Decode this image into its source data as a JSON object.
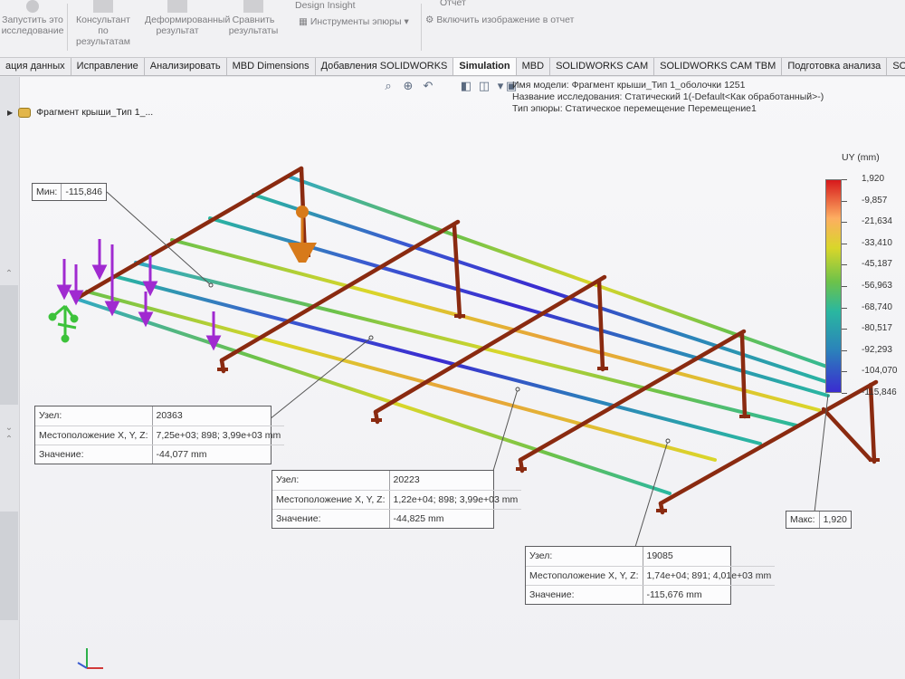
{
  "ribbon": {
    "run_study": "Запустить это исследование",
    "consultant": "Консультант по результатам",
    "deformed": "Деформированный результат",
    "compare": "Сравнить результаты",
    "design_insight": "Design Insight",
    "plot_tools": "Инструменты эпюры",
    "report": "Отчет",
    "include_image": "Включить изображение в отчет"
  },
  "tabs": [
    {
      "label": "ация данных",
      "active": false
    },
    {
      "label": "Исправление",
      "active": false
    },
    {
      "label": "Анализировать",
      "active": false
    },
    {
      "label": "MBD Dimensions",
      "active": false
    },
    {
      "label": "Добавления SOLIDWORKS",
      "active": false
    },
    {
      "label": "Simulation",
      "active": true
    },
    {
      "label": "MBD",
      "active": false
    },
    {
      "label": "SOLIDWORKS CAM",
      "active": false
    },
    {
      "label": "SOLIDWORKS CAM TBM",
      "active": false
    },
    {
      "label": "Подготовка анализа",
      "active": false
    },
    {
      "label": "SOLIDWORKS Inspection",
      "active": false
    }
  ],
  "tree": {
    "label": "Фрагмент крыши_Тип 1_..."
  },
  "info": {
    "model_name": "Имя модели: Фрагмент крыши_Тип 1_оболочки 1251",
    "study_name": "Название исследования: Статический 1(-Default<Как обработанный>-)",
    "plot_type": "Тип эпюры: Статическое перемещение Перемещение1"
  },
  "legend": {
    "unit": "UY (mm)",
    "labels": [
      "1,920",
      "-9,857",
      "-21,634",
      "-33,410",
      "-45,187",
      "-56,963",
      "-68,740",
      "-80,517",
      "-92,293",
      "-104,070",
      "-115,846"
    ]
  },
  "min_box": {
    "label": "Мин:",
    "value": "-115,846"
  },
  "max_box": {
    "label": "Макс:",
    "value": "1,920"
  },
  "probes": [
    {
      "node_label": "Узел:",
      "node": "20363",
      "loc_label": "Местоположение X, Y, Z:",
      "loc": "7,25e+03; 898; 3,99e+03 mm",
      "val_label": "Значение:",
      "value": "-44,077 mm"
    },
    {
      "node_label": "Узел:",
      "node": "20223",
      "loc_label": "Местоположение X, Y, Z:",
      "loc": "1,22e+04; 898; 3,99e+03 mm",
      "val_label": "Значение:",
      "value": "-44,825 mm"
    },
    {
      "node_label": "Узел:",
      "node": "19085",
      "loc_label": "Местоположение X, Y, Z:",
      "loc": "1,74e+04; 891; 4,01e+03 mm",
      "val_label": "Значение:",
      "value": "-115,676 mm"
    }
  ],
  "colors": {
    "frame": "#8a2a10",
    "load_arrow": "#a02ad0",
    "fixture": "#3cc23a",
    "remote_load": "#d77a1a"
  }
}
